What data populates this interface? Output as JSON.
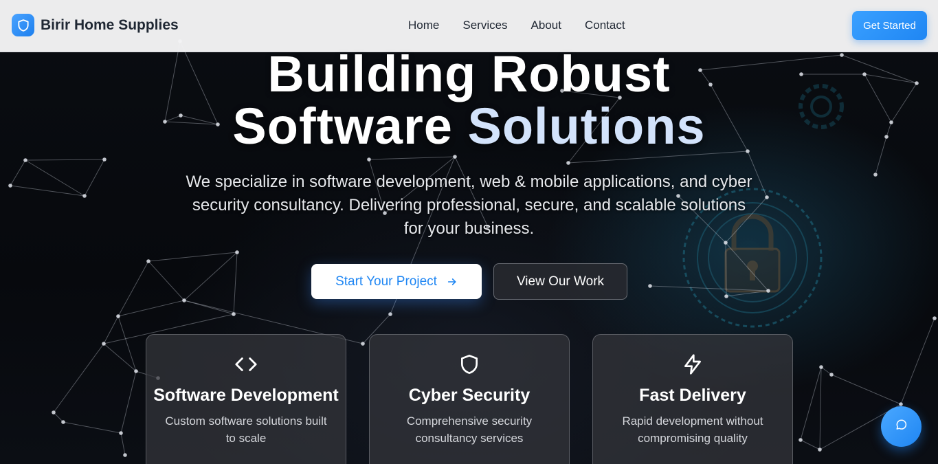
{
  "nav": {
    "brand_name": "Birir Home Supplies",
    "brand_icon": "shield-icon",
    "links": [
      "Home",
      "Services",
      "About",
      "Contact"
    ],
    "cta_label": "Get Started"
  },
  "hero": {
    "title_line1": "Building Robust",
    "title_line2_a": "Software",
    "title_line2_b": "Solutions",
    "subtitle": "We specialize in software development, web & mobile applications, and cyber security consultancy. Delivering professional, secure, and scalable solutions for your business.",
    "primary_button": "Start Your Project",
    "secondary_button": "View Our Work"
  },
  "features": [
    {
      "icon": "code-icon",
      "title": "Software Development",
      "description": "Custom software solutions built to scale"
    },
    {
      "icon": "shield-icon",
      "title": "Cyber Security",
      "description": "Comprehensive security consultancy services"
    },
    {
      "icon": "lightning-icon",
      "title": "Fast Delivery",
      "description": "Rapid development without compromising quality"
    }
  ],
  "chat": {
    "icon": "chat-bubble-icon"
  },
  "colors": {
    "accent": "#1f86f3",
    "title_accent": "#d3e3fb"
  }
}
